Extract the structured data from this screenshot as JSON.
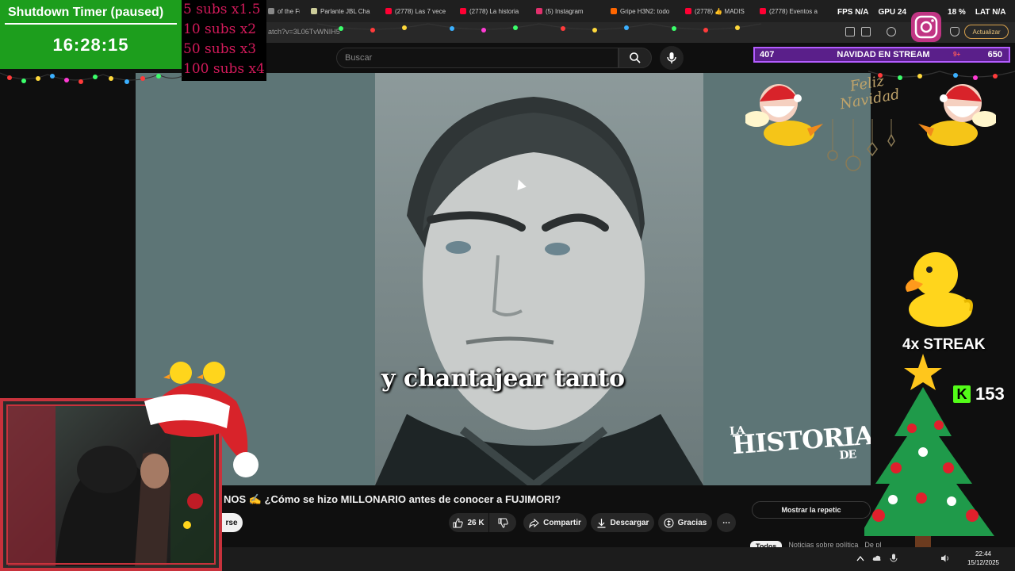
{
  "browser": {
    "tabs": [
      {
        "label": "of the Fut",
        "color": "#888888"
      },
      {
        "label": "Parlante JBL Cha",
        "color": "#cccc99"
      },
      {
        "label": "(2778) Las 7 vece",
        "color": "#ff0033"
      },
      {
        "label": "(2778) La historia",
        "color": "#ff0033"
      },
      {
        "label": "(5) Instagram",
        "color": "#e1306c"
      },
      {
        "label": "Gripe H3N2: todo",
        "color": "#ff6600"
      },
      {
        "label": "(2778) 👍 MADIS",
        "color": "#ff0033"
      },
      {
        "label": "(2778) Eventos a",
        "color": "#ff0033"
      }
    ],
    "url": "atch?v=3L06TvWNIH5",
    "update_label": "Actualizar"
  },
  "stats": {
    "fps": "FPS N/A",
    "gpu": "GPU 24",
    "cpu": "18 %",
    "lat": "LAT N/A"
  },
  "youtube": {
    "search_placeholder": "Buscar",
    "video": {
      "subtitle": "y chantajear tanto",
      "watermark_la": "LA",
      "watermark_main": "HISTORIA",
      "watermark_de": "DE"
    },
    "title": "NOS ✍️ ¿Cómo se hizo MILLONARIO antes de conocer a FUJIMORI?",
    "subscribe_label": "rse",
    "actions": {
      "likes": "26 K",
      "share": "Compartir",
      "download": "Descargar",
      "thanks": "Gracias",
      "more": "⋯"
    },
    "replay_label": "Mostrar la repetic",
    "chips": [
      "Todos",
      "Noticias sobre política",
      "De pl"
    ]
  },
  "taskbar": {
    "time": "22:44",
    "date": "15/12/2025"
  },
  "overlay": {
    "timer_title": "Shutdown Timer (paused)",
    "timer_value": "16:28:15",
    "subs_multipliers": [
      "5 subs x1.5",
      "10 subs x2",
      "50 subs x3",
      "100 subs x4"
    ],
    "goal": {
      "left": "407",
      "title": "NAVIDAD EN STREAM",
      "badge": "9+",
      "right": "650"
    },
    "greeting": "Feliz Navidad",
    "streak": "4x STREAK",
    "kick_count": "153"
  }
}
